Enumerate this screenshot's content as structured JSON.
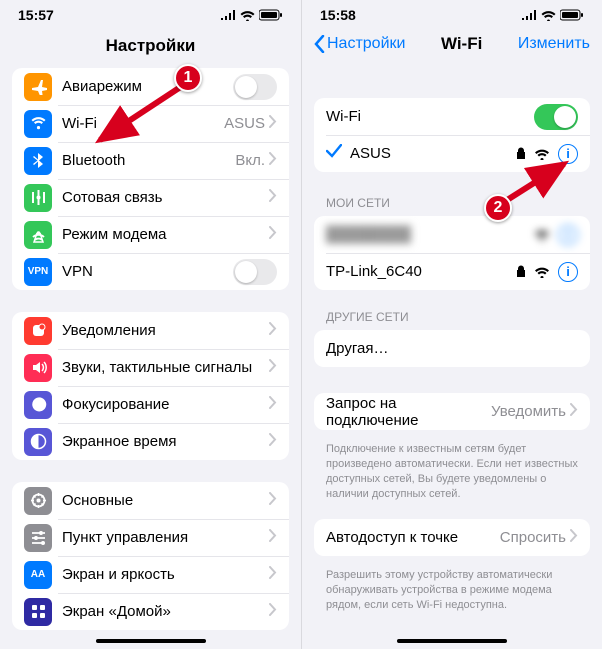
{
  "left": {
    "status_time": "15:57",
    "title": "Настройки",
    "group1": [
      {
        "name": "airplane",
        "label": "Авиарежим",
        "kind": "toggle-off",
        "bg": "#ff9500"
      },
      {
        "name": "wifi",
        "label": "Wi-Fi",
        "value": "ASUS",
        "bg": "#007aff"
      },
      {
        "name": "bluetooth",
        "label": "Bluetooth",
        "value": "Вкл.",
        "bg": "#007aff"
      },
      {
        "name": "cellular",
        "label": "Сотовая связь",
        "bg": "#34c759"
      },
      {
        "name": "hotspot",
        "label": "Режим модема",
        "bg": "#34c759"
      },
      {
        "name": "vpn",
        "label": "VPN",
        "kind": "toggle-off",
        "bg": "#007aff",
        "text": "VPN"
      }
    ],
    "group2": [
      {
        "name": "notifications",
        "label": "Уведомления",
        "bg": "#ff3b30"
      },
      {
        "name": "sounds",
        "label": "Звуки, тактильные сигналы",
        "bg": "#ff2d55"
      },
      {
        "name": "focus",
        "label": "Фокусирование",
        "bg": "#5856d6"
      },
      {
        "name": "screentime",
        "label": "Экранное время",
        "bg": "#5856d6"
      }
    ],
    "group3": [
      {
        "name": "general",
        "label": "Основные",
        "bg": "#8e8e93"
      },
      {
        "name": "controlcenter",
        "label": "Пункт управления",
        "bg": "#8e8e93"
      },
      {
        "name": "display",
        "label": "Экран и яркость",
        "bg": "#007aff",
        "text": "AA"
      },
      {
        "name": "homescreen",
        "label": "Экран «Домой»",
        "bg": "#2f2aa3"
      }
    ]
  },
  "right": {
    "status_time": "15:58",
    "back": "Настройки",
    "title": "Wi-Fi",
    "edit": "Изменить",
    "toggle_label": "Wi-Fi",
    "connected": "ASUS",
    "my_nets_header": "МОИ СЕТИ",
    "my_nets": [
      {
        "name": "blurred",
        "label": "████████",
        "blur": true
      },
      {
        "name": "tplink",
        "label": "TP-Link_6C40"
      }
    ],
    "other_header": "ДРУГИЕ СЕТИ",
    "other_label": "Другая…",
    "ask": {
      "label": "Запрос на подключение",
      "value": "Уведомить",
      "foot": "Подключение к известным сетям будет произведено автоматически. Если нет известных доступных сетей, Вы будете уведомлены о наличии доступных сетей."
    },
    "auto": {
      "label": "Автодоступ к точке",
      "value": "Спросить",
      "foot": "Разрешить этому устройству автоматически обнаруживать устройства в режиме модема рядом, если сеть Wi-Fi недоступна."
    }
  },
  "callouts": {
    "c1": "1",
    "c2": "2"
  }
}
